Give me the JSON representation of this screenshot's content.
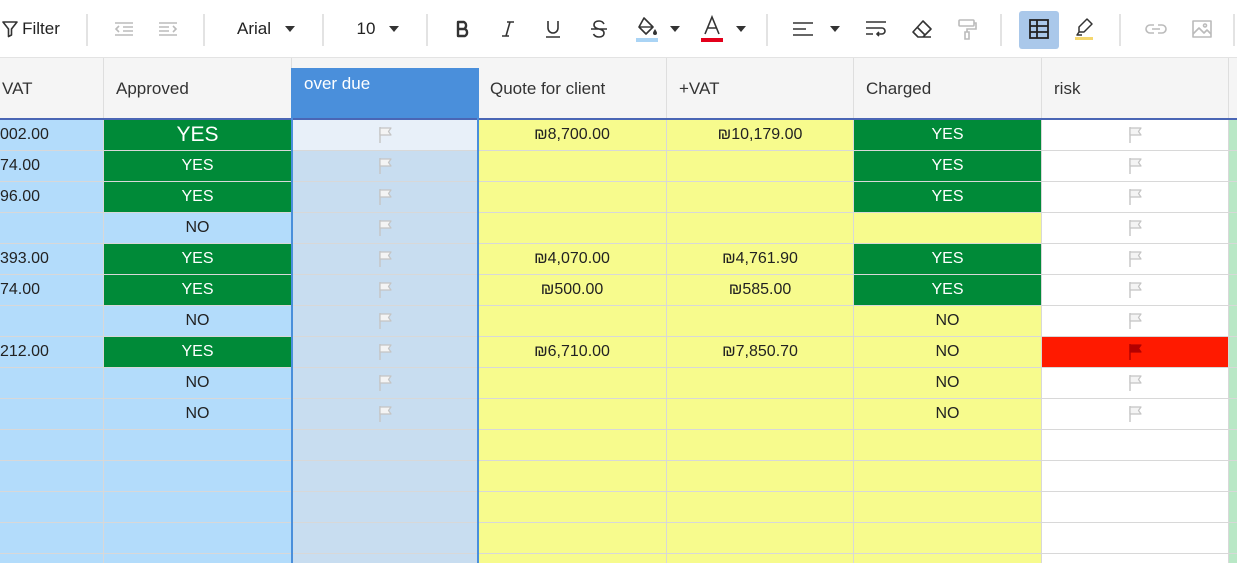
{
  "toolbar": {
    "filter_label": "Filter",
    "font_name": "Arial",
    "font_size": "10",
    "icons": [
      "filter-icon",
      "decrease-indent-icon",
      "increase-indent-icon",
      "bold-icon",
      "italic-icon",
      "underline-icon",
      "strikethrough-icon",
      "fill-color-icon",
      "text-color-icon",
      "align-left-icon",
      "wrap-text-icon",
      "clear-format-icon",
      "paint-format-icon",
      "table-view-icon",
      "highlight-icon",
      "link-icon",
      "image-icon"
    ],
    "colors": {
      "fill_indicator": "#aad4f5",
      "text_color_indicator": "#e3001b",
      "highlight_indicator": "#f5d76e",
      "selected_tool_bg": "#aac8ea"
    }
  },
  "columns": [
    {
      "key": "vat",
      "label": "VAT"
    },
    {
      "key": "approved",
      "label": "Approved"
    },
    {
      "key": "overdue",
      "label": "over due"
    },
    {
      "key": "quote",
      "label": "Quote for client"
    },
    {
      "key": "plusvat",
      "label": "+VAT"
    },
    {
      "key": "charged",
      "label": "Charged"
    },
    {
      "key": "risk",
      "label": "risk"
    }
  ],
  "rows": [
    {
      "vat": "002.00",
      "approved": "YES",
      "quote": "₪8,700.00",
      "plusvat": "₪10,179.00",
      "charged": "YES",
      "risk_flag": false
    },
    {
      "vat": "74.00",
      "approved": "YES",
      "quote": "",
      "plusvat": "",
      "charged": "YES",
      "risk_flag": false
    },
    {
      "vat": "96.00",
      "approved": "YES",
      "quote": "",
      "plusvat": "",
      "charged": "YES",
      "risk_flag": false
    },
    {
      "vat": "",
      "approved": "NO",
      "quote": "",
      "plusvat": "",
      "charged": "",
      "risk_flag": false
    },
    {
      "vat": "393.00",
      "approved": "YES",
      "quote": "₪4,070.00",
      "plusvat": "₪4,761.90",
      "charged": "YES",
      "risk_flag": false
    },
    {
      "vat": "74.00",
      "approved": "YES",
      "quote": "₪500.00",
      "plusvat": "₪585.00",
      "charged": "YES",
      "risk_flag": false
    },
    {
      "vat": "",
      "approved": "NO",
      "quote": "",
      "plusvat": "",
      "charged": "NO",
      "risk_flag": false
    },
    {
      "vat": "212.00",
      "approved": "YES",
      "quote": "₪6,710.00",
      "plusvat": "₪7,850.70",
      "charged": "NO",
      "risk_flag": true
    },
    {
      "vat": "",
      "approved": "NO",
      "quote": "",
      "plusvat": "",
      "charged": "NO",
      "risk_flag": false
    },
    {
      "vat": "",
      "approved": "NO",
      "quote": "",
      "plusvat": "",
      "charged": "NO",
      "risk_flag": false
    },
    {
      "vat": "",
      "approved": "",
      "quote": "",
      "plusvat": "",
      "charged": "",
      "risk_flag": null
    },
    {
      "vat": "",
      "approved": "",
      "quote": "",
      "plusvat": "",
      "charged": "",
      "risk_flag": null
    },
    {
      "vat": "",
      "approved": "",
      "quote": "",
      "plusvat": "",
      "charged": "",
      "risk_flag": null
    },
    {
      "vat": "",
      "approved": "",
      "quote": "",
      "plusvat": "",
      "charged": "",
      "risk_flag": null
    },
    {
      "vat": "",
      "approved": "",
      "quote": "",
      "plusvat": "",
      "charged": "",
      "risk_flag": null
    }
  ],
  "colors": {
    "approved_yes": "#008a38",
    "charged_yes": "#008a38",
    "risk_flagged": "#ff1a00",
    "vat_col": "#b3dcfb",
    "quote_cols": "#f7fb8d",
    "selected_column_header": "#4a8fdb"
  }
}
